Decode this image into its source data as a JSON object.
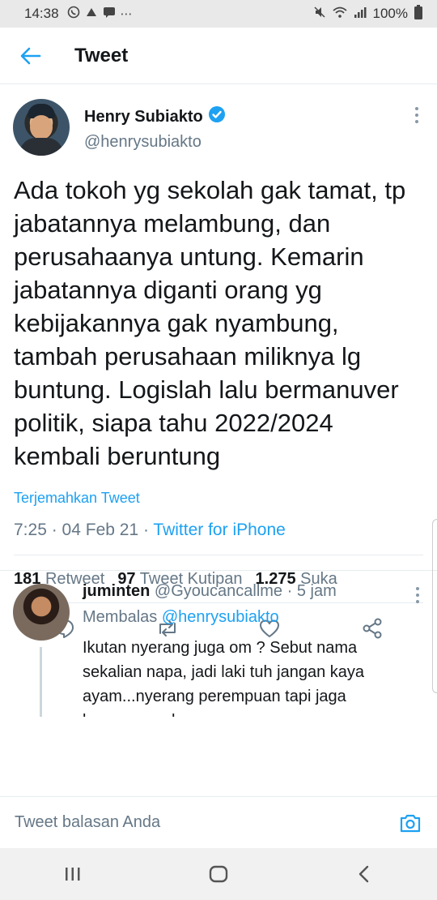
{
  "status_bar": {
    "time": "14:38",
    "battery": "100%"
  },
  "header": {
    "title": "Tweet"
  },
  "tweet": {
    "author_name": "Henry Subiakto",
    "author_handle": "@henrysubiakto",
    "verified": true,
    "text": "Ada tokoh yg sekolah gak tamat, tp jabatannya melambung, dan perusahaanya untung. Kemarin jabatannya diganti orang yg kebijakannya gak nyambung, tambah perusahaan miliknya lg buntung. Logislah lalu bermanuver politik, siapa tahu 2022/2024 kembali beruntung",
    "translate_label": "Terjemahkan Tweet",
    "time": "7:25",
    "date": "04 Feb 21",
    "source": "Twitter for iPhone",
    "stats": [
      {
        "count": "181",
        "label": "Retweet"
      },
      {
        "count": "97",
        "label": "Tweet Kutipan"
      },
      {
        "count": "1.275",
        "label": "Suka"
      }
    ]
  },
  "reply": {
    "name": "juminten",
    "handle": "@Gyoucancallme",
    "time": "5 jam",
    "replying_prefix": "Membalas",
    "replying_to": "@henrysubiakto",
    "text": "Ikutan nyerang juga om ? Sebut nama sekalian napa, jadi laki tuh jangan kaya ayam...nyerang perempuan tapi jaga kesopanan dong"
  },
  "compose": {
    "placeholder": "Tweet balasan Anda"
  },
  "colors": {
    "accent": "#1da1f2",
    "muted": "#657786",
    "text": "#14171a"
  }
}
